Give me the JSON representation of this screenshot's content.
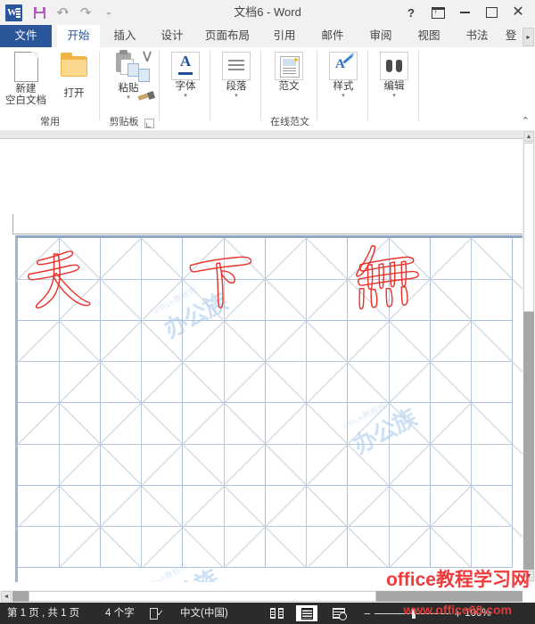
{
  "window": {
    "title": "文档6 - Word",
    "quick_access": [
      {
        "name": "word-logo",
        "label": "W"
      },
      {
        "name": "save",
        "label": "保存"
      },
      {
        "name": "undo",
        "label": "撤消"
      },
      {
        "name": "redo",
        "label": "恢复"
      },
      {
        "name": "customize",
        "label": "自定义快速访问工具栏"
      }
    ],
    "controls": [
      {
        "name": "help",
        "label": "?"
      },
      {
        "name": "ribbon-display-options",
        "label": "功能区显示选项"
      },
      {
        "name": "minimize",
        "label": "最小化"
      },
      {
        "name": "maximize",
        "label": "最大化"
      },
      {
        "name": "close",
        "label": "✕"
      }
    ]
  },
  "tabs": [
    {
      "label": "文件",
      "key": "file"
    },
    {
      "label": "开始",
      "key": "home"
    },
    {
      "label": "插入",
      "key": "insert"
    },
    {
      "label": "设计",
      "key": "design"
    },
    {
      "label": "页面布局",
      "key": "layout"
    },
    {
      "label": "引用",
      "key": "references"
    },
    {
      "label": "邮件",
      "key": "mailings"
    },
    {
      "label": "审阅",
      "key": "review"
    },
    {
      "label": "视图",
      "key": "view"
    },
    {
      "label": "书法",
      "key": "calligraphy"
    },
    {
      "label": "登",
      "key": "login"
    }
  ],
  "active_tab": "开始",
  "tab_scroll_label": "▸",
  "ribbon": {
    "collapse_label": "⌃",
    "groups": [
      {
        "name": "常用",
        "label": "常用",
        "items": [
          {
            "label": "新建",
            "label2": "空白文档",
            "icon": "new-document-icon",
            "caret": false
          },
          {
            "label": "打开",
            "label2": "",
            "icon": "open-folder-icon",
            "caret": false
          }
        ]
      },
      {
        "name": "剪贴板",
        "label": "剪贴板",
        "dialog_launcher": true,
        "items": [
          {
            "label": "粘贴",
            "label2": "",
            "icon": "paste-icon",
            "caret": true
          }
        ]
      },
      {
        "name": "字体组",
        "label": "",
        "items": [
          {
            "label": "字体",
            "label2": "",
            "icon": "font-icon",
            "caret": true
          }
        ]
      },
      {
        "name": "段落组",
        "label": "",
        "items": [
          {
            "label": "段落",
            "label2": "",
            "icon": "paragraph-icon",
            "caret": true
          }
        ]
      },
      {
        "name": "在线范文",
        "label": "在线范文",
        "items": [
          {
            "label": "范文",
            "label2": "",
            "icon": "sample-document-icon",
            "caret": false
          }
        ]
      },
      {
        "name": "样式组",
        "label": "",
        "items": [
          {
            "label": "样式",
            "label2": "",
            "icon": "styles-icon",
            "caret": true
          }
        ]
      },
      {
        "name": "编辑组",
        "label": "",
        "items": [
          {
            "label": "编辑",
            "label2": "",
            "icon": "find-binoculars-icon",
            "caret": true
          }
        ]
      }
    ]
  },
  "document": {
    "grid_type": "米字格",
    "columns": 6,
    "rows": 4,
    "characters": [
      {
        "char": "天",
        "col": 0,
        "row": 0
      },
      {
        "char": "下",
        "col": 2,
        "row": 0
      },
      {
        "char": "无",
        "col": 4,
        "row": 0
      }
    ],
    "ink_color": "#e8352e",
    "grid_color": "#aebfd6",
    "watermark_small": "office教程网",
    "watermark_big": "办公族"
  },
  "status": {
    "page_info": "第 1 页 , 共 1 页",
    "word_count": "4 个字",
    "proofing_label": "校对",
    "language": "中文(中国)",
    "views": [
      {
        "name": "read-mode",
        "label": "阅读视图",
        "active": false
      },
      {
        "name": "print-layout",
        "label": "页面视图",
        "active": true
      },
      {
        "name": "web-layout",
        "label": "Web 版式视图",
        "active": false
      }
    ],
    "zoom_minus": "−",
    "zoom_plus": "+",
    "zoom_level": "100%"
  },
  "site_watermarks": {
    "line1": "office教程学习网",
    "line2": "www.office68.com"
  }
}
